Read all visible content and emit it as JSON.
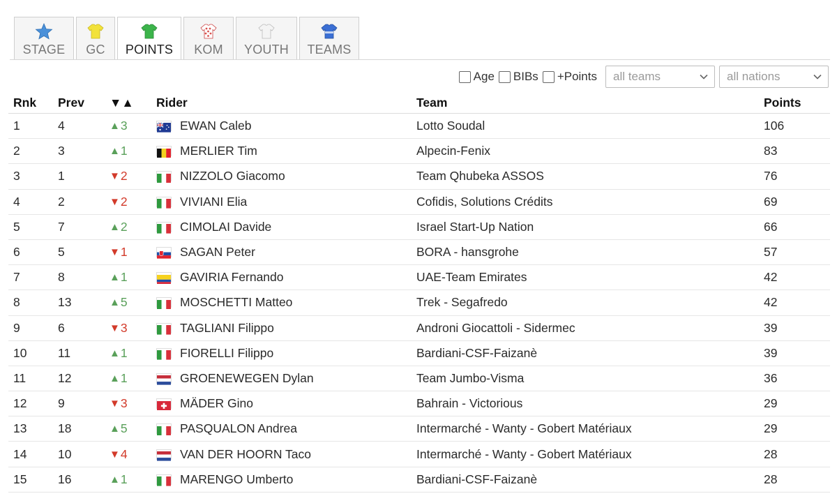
{
  "tabs": [
    {
      "label": "STAGE",
      "icon": "star-icon",
      "color": "#4a90d9",
      "active": false
    },
    {
      "label": "GC",
      "icon": "yellow-jersey-icon",
      "color": "#f2e23b",
      "active": false
    },
    {
      "label": "POINTS",
      "icon": "green-jersey-icon",
      "color": "#3cb44b",
      "active": true
    },
    {
      "label": "KOM",
      "icon": "polka-dot-jersey-icon",
      "color": "#d9534f",
      "active": false
    },
    {
      "label": "YOUTH",
      "icon": "white-jersey-icon",
      "color": "#e8e8e8",
      "active": false
    },
    {
      "label": "TEAMS",
      "icon": "blue-jersey-icon",
      "color": "#3b6fd4",
      "active": false
    }
  ],
  "filters": {
    "age_label": "Age",
    "bibs_label": "BIBs",
    "points_label": "+Points",
    "teams_select": "all teams",
    "nations_select": "all nations"
  },
  "table": {
    "headers": {
      "rnk": "Rnk",
      "prev": "Prev",
      "diff": "▼▲",
      "rider": "Rider",
      "team": "Team",
      "points": "Points"
    },
    "rows": [
      {
        "rnk": "1",
        "prev": "4",
        "dir": "up",
        "delta": "3",
        "flag": "au",
        "rider": "EWAN Caleb",
        "team": "Lotto Soudal",
        "points": "106"
      },
      {
        "rnk": "2",
        "prev": "3",
        "dir": "up",
        "delta": "1",
        "flag": "be",
        "rider": "MERLIER Tim",
        "team": "Alpecin-Fenix",
        "points": "83"
      },
      {
        "rnk": "3",
        "prev": "1",
        "dir": "down",
        "delta": "2",
        "flag": "it",
        "rider": "NIZZOLO Giacomo",
        "team": "Team Qhubeka ASSOS",
        "points": "76"
      },
      {
        "rnk": "4",
        "prev": "2",
        "dir": "down",
        "delta": "2",
        "flag": "it",
        "rider": "VIVIANI Elia",
        "team": "Cofidis, Solutions Crédits",
        "points": "69"
      },
      {
        "rnk": "5",
        "prev": "7",
        "dir": "up",
        "delta": "2",
        "flag": "it",
        "rider": "CIMOLAI Davide",
        "team": "Israel Start-Up Nation",
        "points": "66"
      },
      {
        "rnk": "6",
        "prev": "5",
        "dir": "down",
        "delta": "1",
        "flag": "sk",
        "rider": "SAGAN Peter",
        "team": "BORA - hansgrohe",
        "points": "57"
      },
      {
        "rnk": "7",
        "prev": "8",
        "dir": "up",
        "delta": "1",
        "flag": "co",
        "rider": "GAVIRIA Fernando",
        "team": "UAE-Team Emirates",
        "points": "42"
      },
      {
        "rnk": "8",
        "prev": "13",
        "dir": "up",
        "delta": "5",
        "flag": "it",
        "rider": "MOSCHETTI Matteo",
        "team": "Trek - Segafredo",
        "points": "42"
      },
      {
        "rnk": "9",
        "prev": "6",
        "dir": "down",
        "delta": "3",
        "flag": "it",
        "rider": "TAGLIANI Filippo",
        "team": "Androni Giocattoli - Sidermec",
        "points": "39"
      },
      {
        "rnk": "10",
        "prev": "11",
        "dir": "up",
        "delta": "1",
        "flag": "it",
        "rider": "FIORELLI Filippo",
        "team": "Bardiani-CSF-Faizanè",
        "points": "39"
      },
      {
        "rnk": "11",
        "prev": "12",
        "dir": "up",
        "delta": "1",
        "flag": "nl",
        "rider": "GROENEWEGEN Dylan",
        "team": "Team Jumbo-Visma",
        "points": "36"
      },
      {
        "rnk": "12",
        "prev": "9",
        "dir": "down",
        "delta": "3",
        "flag": "ch",
        "rider": "MÄDER Gino",
        "team": "Bahrain - Victorious",
        "points": "29"
      },
      {
        "rnk": "13",
        "prev": "18",
        "dir": "up",
        "delta": "5",
        "flag": "it",
        "rider": "PASQUALON Andrea",
        "team": "Intermarché - Wanty - Gobert Matériaux",
        "points": "29"
      },
      {
        "rnk": "14",
        "prev": "10",
        "dir": "down",
        "delta": "4",
        "flag": "nl",
        "rider": "VAN DER HOORN Taco",
        "team": "Intermarché - Wanty - Gobert Matériaux",
        "points": "28"
      },
      {
        "rnk": "15",
        "prev": "16",
        "dir": "up",
        "delta": "1",
        "flag": "it",
        "rider": "MARENGO Umberto",
        "team": "Bardiani-CSF-Faizanè",
        "points": "28"
      }
    ]
  }
}
